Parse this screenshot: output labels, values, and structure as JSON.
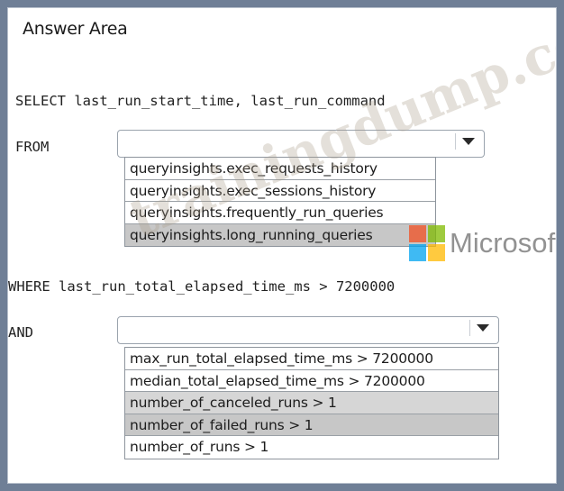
{
  "title": "Answer Area",
  "code": {
    "select_line": "SELECT last_run_start_time, last_run_command",
    "from_keyword": "FROM",
    "where_line": "WHERE last_run_total_elapsed_time_ms > 7200000",
    "and_keyword": "AND"
  },
  "from_dropdown": {
    "selected": "",
    "options": [
      "queryinsights.exec_requests_history",
      "queryinsights.exec_sessions_history",
      "queryinsights.frequently_run_queries",
      "queryinsights.long_running_queries"
    ]
  },
  "and_dropdown": {
    "selected": "",
    "options": [
      "max_run_total_elapsed_time_ms > 7200000",
      "median_total_elapsed_time_ms > 7200000",
      "number_of_canceled_runs > 1",
      "number_of_failed_runs > 1",
      "number_of_runs > 1"
    ]
  },
  "watermarks": {
    "site": "trainingdump.com",
    "brand": "Microsoft"
  }
}
